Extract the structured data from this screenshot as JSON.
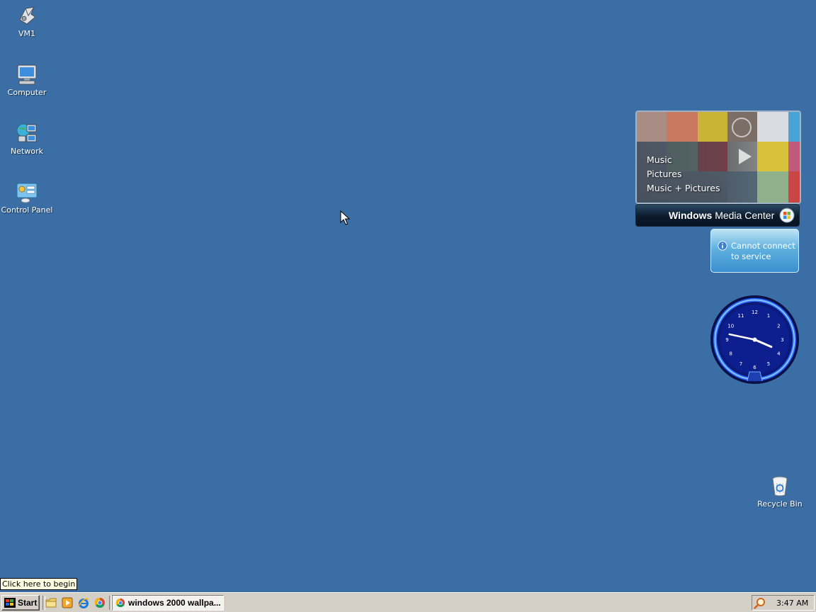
{
  "desktop": {
    "background_color": "#3a6ea5",
    "icons": [
      {
        "label": "VM1",
        "icon": "vm-icon"
      },
      {
        "label": "Computer",
        "icon": "computer-icon"
      },
      {
        "label": "Network",
        "icon": "network-icon"
      },
      {
        "label": "Control Panel",
        "icon": "control-panel-icon"
      },
      {
        "label": "Recycle Bin",
        "icon": "recycle-bin-icon"
      }
    ]
  },
  "gadgets": {
    "media_center": {
      "menu": [
        "Music",
        "Pictures",
        "Music + Pictures"
      ],
      "brand_bold": "Windows",
      "brand_rest": " Media Center"
    },
    "weather": {
      "message_line1": "Cannot connect",
      "message_line2": "to service"
    },
    "clock": {
      "time": "3:47",
      "numerals": [
        "12",
        "1",
        "2",
        "3",
        "4",
        "5",
        "6",
        "7",
        "8",
        "9",
        "10",
        "11"
      ]
    }
  },
  "tooltip": "Click here to begin",
  "taskbar": {
    "start_label": "Start",
    "quick_launch": [
      "folder-icon",
      "media-player-icon",
      "ie-icon",
      "chrome-icon"
    ],
    "tasks": [
      {
        "label": "windows 2000 wallpa...",
        "icon": "chrome-icon"
      }
    ],
    "tray_clock": "3:47 AM"
  }
}
